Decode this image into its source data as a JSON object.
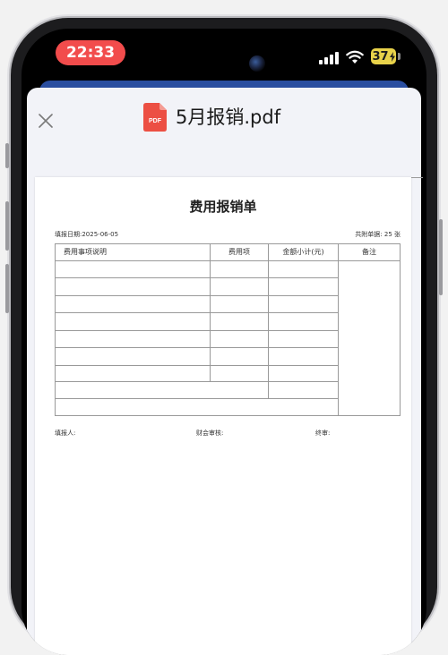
{
  "status_bar": {
    "time": "22:33",
    "battery_level": "37",
    "icons": [
      "signal-icon",
      "wifi-icon",
      "battery-icon"
    ]
  },
  "header": {
    "close_icon": "close-icon",
    "file_icon_label": "PDF",
    "file_name": "5月报销.pdf"
  },
  "document": {
    "title": "费用报销单",
    "fill_date": "填报日期:2025-06-05",
    "attachments": "共附单据: 25 张",
    "columns": [
      "费用事项说明",
      "费用项",
      "金额小计(元)",
      "备注"
    ],
    "signatures": {
      "filler": "填报人:",
      "finance": "财会审核:",
      "final": "终审:"
    }
  },
  "colors": {
    "time_pill": "#f24c4c",
    "battery": "#e8d24a",
    "pdf_icon": "#ec4f43",
    "sheet_under": "#2a4ea0"
  }
}
